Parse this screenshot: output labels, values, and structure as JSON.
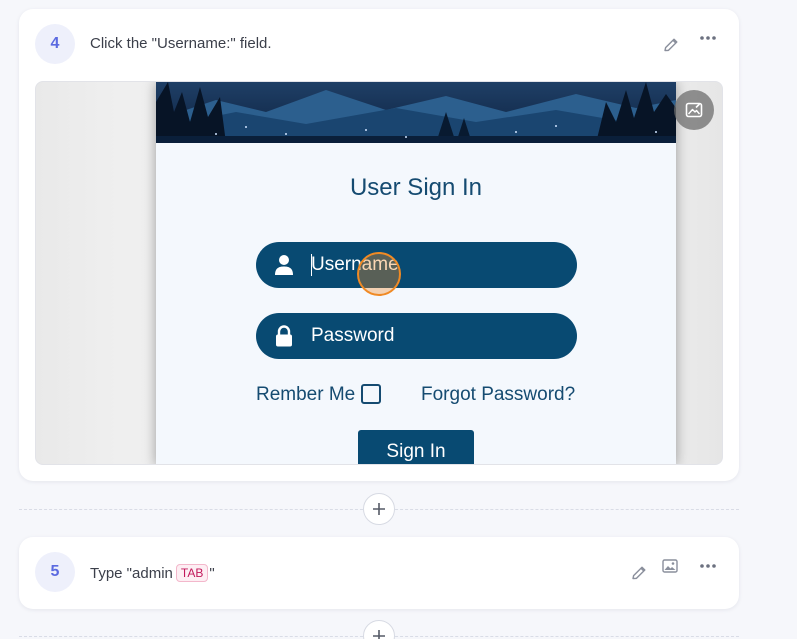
{
  "steps": [
    {
      "number": "4",
      "instruction": "Click the \"Username:\" field.",
      "actions": [
        "edit-icon",
        "more-icon"
      ],
      "screenshot": {
        "edit_image_icon": "image-edit-icon",
        "app": {
          "title": "User Sign In",
          "username_placeholder": "Username",
          "password_placeholder": "Password",
          "remember_label": "Rember Me",
          "remember_checked": false,
          "forgot_link": "Forgot Password?",
          "signin_button": "Sign In"
        },
        "click_marker_color": "#f08a24"
      }
    },
    {
      "number": "5",
      "instruction_prefix": "Type \"admin",
      "key": "TAB",
      "instruction_suffix": "\"",
      "actions": [
        "edit-icon",
        "image-icon",
        "more-icon"
      ]
    }
  ],
  "colors": {
    "accent": "#5b6ae0",
    "app_primary": "#084a72",
    "app_text": "#154b71",
    "key_badge": "#c2185b"
  },
  "add_step_icon": "plus-icon"
}
